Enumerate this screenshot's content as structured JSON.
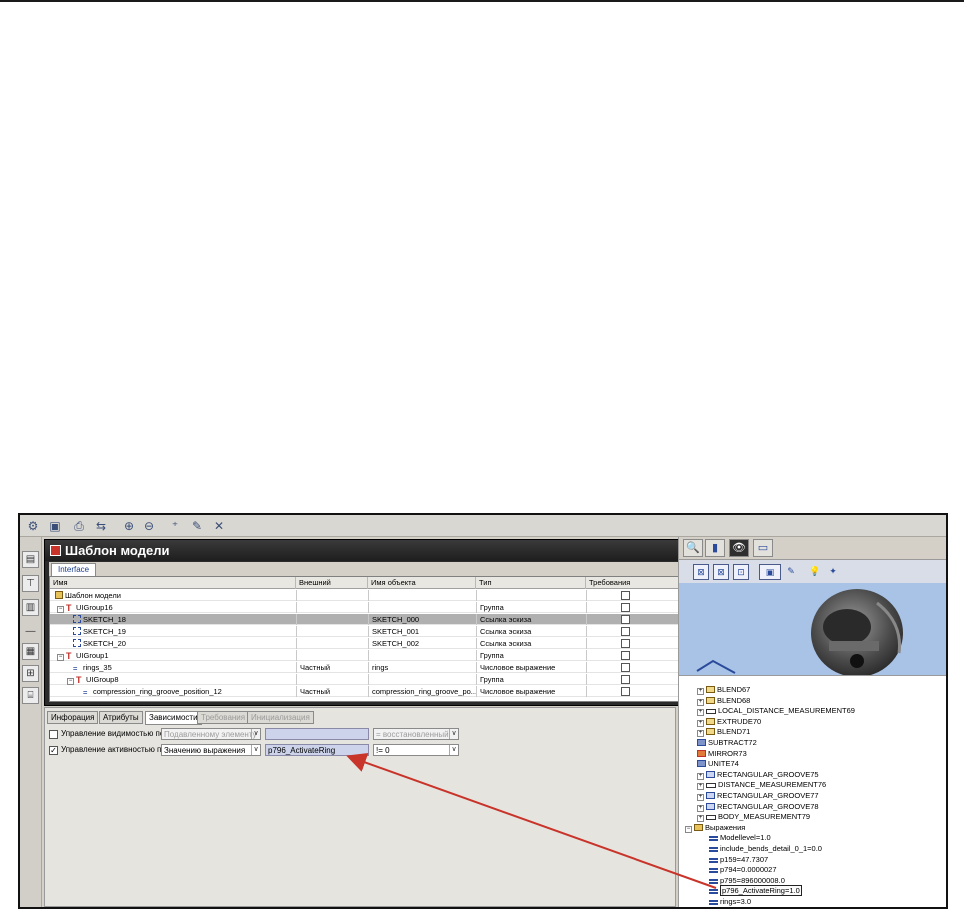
{
  "toolbar": {
    "icons": [
      "feature-icon",
      "save-icon",
      "print-icon",
      "shuffle-icon",
      "zoom-in-icon",
      "zoom-out-icon",
      "add-point-icon",
      "pen-icon",
      "close-icon"
    ],
    "glyphs": [
      "⚙",
      "▣",
      "⎙",
      "⇆",
      "⊕",
      "⊖",
      "⁺",
      "✎",
      "✕"
    ]
  },
  "left_strip": {
    "glyphs": [
      "▤",
      "⊤",
      "▥",
      "—",
      "▦",
      "⊞",
      "⌸"
    ]
  },
  "dialog": {
    "title": "Шаблон модели",
    "restore_glyph": "⧉",
    "tab": "Interface",
    "columns": [
      "Имя",
      "Внешний",
      "Имя объекта",
      "Тип",
      "Требования"
    ],
    "rows": [
      {
        "name": "Шаблон модели",
        "ext": "",
        "obj": "",
        "type": "",
        "icon": "folder"
      },
      {
        "name": "UIGroup16",
        "ext": "",
        "obj": "",
        "type": "Группа",
        "icon": "group",
        "pm": "⊟"
      },
      {
        "name": "SKETCH_18",
        "ext": "",
        "obj": "SKETCH_000",
        "type": "Ссылка эскиза",
        "icon": "sketch",
        "sel": true
      },
      {
        "name": "SKETCH_19",
        "ext": "",
        "obj": "SKETCH_001",
        "type": "Ссылка эскиза",
        "icon": "sketch"
      },
      {
        "name": "SKETCH_20",
        "ext": "",
        "obj": "SKETCH_002",
        "type": "Ссылка эскиза",
        "icon": "sketch"
      },
      {
        "name": "UIGroup1",
        "ext": "",
        "obj": "",
        "type": "Группа",
        "icon": "group",
        "pm": "⊟"
      },
      {
        "name": "rings_35",
        "ext": "Частный",
        "obj": "rings",
        "type": "Числовое выражение",
        "icon": "expr"
      },
      {
        "name": "UIGroup8",
        "ext": "",
        "obj": "",
        "type": "Группа",
        "icon": "group",
        "pm": "⊟"
      },
      {
        "name": "compression_ring_groove_position_12",
        "ext": "Частный",
        "obj": "compression_ring_groove_po...",
        "type": "Числовое выражение",
        "icon": "expr"
      }
    ]
  },
  "bottom": {
    "tabs": [
      {
        "label": "Инфорация",
        "state": "normal"
      },
      {
        "label": "Атрибуты",
        "state": "normal"
      },
      {
        "label": "Зависимости",
        "state": "active"
      },
      {
        "label": "Требования",
        "state": "disabled"
      },
      {
        "label": "Инициализация",
        "state": "disabled"
      }
    ],
    "visibility": {
      "label": "Управление видимостью по",
      "checked": false,
      "mode": "Подавленному элементу",
      "field": "",
      "operator": "= восстановленный"
    },
    "activity": {
      "label": "Управление активностью по",
      "checked": true,
      "mode": "Значению выражения",
      "field": "p796_ActivateRing",
      "operator": "!= 0"
    }
  },
  "right": {
    "tabs": [
      "🔍",
      "▮",
      "👁",
      "▭"
    ],
    "tools": [
      "⊠",
      "⊠",
      "⊡",
      "▣",
      "✎",
      "💡",
      "✦"
    ],
    "tree": [
      {
        "label": "BLEND67",
        "icon": "blend",
        "pm": "⊞",
        "indent": 1
      },
      {
        "label": "BLEND68",
        "icon": "blend",
        "pm": "⊞",
        "indent": 1
      },
      {
        "label": "LOCAL_DISTANCE_MEASUREMENT69",
        "icon": "meas",
        "pm": "⊞",
        "indent": 1
      },
      {
        "label": "EXTRUDE70",
        "icon": "blend",
        "pm": "⊞",
        "indent": 1
      },
      {
        "label": "BLEND71",
        "icon": "blend",
        "pm": "⊞",
        "indent": 1
      },
      {
        "label": "SUBTRACT72",
        "icon": "op",
        "pm": "",
        "indent": 1
      },
      {
        "label": "MIRROR73",
        "icon": "mir",
        "pm": "",
        "indent": 1
      },
      {
        "label": "UNITE74",
        "icon": "op",
        "pm": "",
        "indent": 1
      },
      {
        "label": "RECTANGULAR_GROOVE75",
        "icon": "grv",
        "pm": "⊞",
        "indent": 1
      },
      {
        "label": "DISTANCE_MEASUREMENT76",
        "icon": "meas",
        "pm": "⊞",
        "indent": 1
      },
      {
        "label": "RECTANGULAR_GROOVE77",
        "icon": "grv",
        "pm": "⊞",
        "indent": 1
      },
      {
        "label": "RECTANGULAR_GROOVE78",
        "icon": "grv",
        "pm": "⊞",
        "indent": 1
      },
      {
        "label": "BODY_MEASUREMENT79",
        "icon": "meas",
        "pm": "⊞",
        "indent": 1
      },
      {
        "label": "Выражения",
        "icon": "fold",
        "pm": "⊟",
        "indent": 0
      },
      {
        "label": "Modellevel=1.0",
        "icon": "eq",
        "pm": "",
        "indent": 2
      },
      {
        "label": "include_bends_detail_0_1=0.0",
        "icon": "eq",
        "pm": "",
        "indent": 2
      },
      {
        "label": "p159=47.7307",
        "icon": "eq",
        "pm": "",
        "indent": 2
      },
      {
        "label": "p794=0.0000027",
        "icon": "eq",
        "pm": "",
        "indent": 2
      },
      {
        "label": "p795=896000008.0",
        "icon": "eq",
        "pm": "",
        "indent": 2
      },
      {
        "label": "p796_ActivateRing=1.0",
        "icon": "eq",
        "pm": "",
        "indent": 2,
        "hl": true
      },
      {
        "label": "rings=3.0",
        "icon": "eq",
        "pm": "",
        "indent": 2
      }
    ]
  },
  "colors": {
    "arrow": "#c8342a",
    "selection": "#b0b0b0",
    "field_bg": "#ccd3ea"
  }
}
